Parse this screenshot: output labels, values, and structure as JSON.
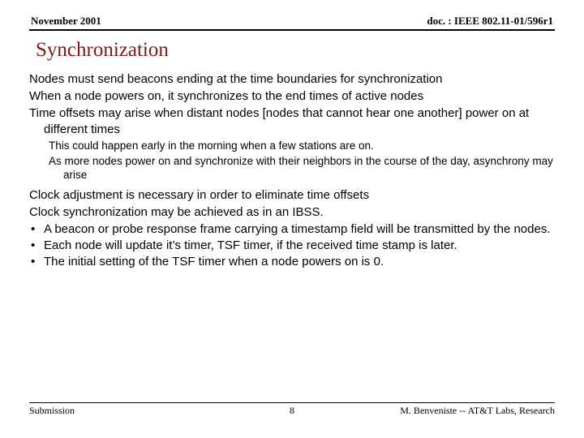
{
  "header": {
    "left": "November 2001",
    "right": "doc. : IEEE 802.11-01/596r1"
  },
  "title": "Synchronization",
  "body": {
    "p1": "Nodes must send beacons ending at the time boundaries for synchronization",
    "p2": "When a node powers on, it synchronizes to the end times of active nodes",
    "p3": "Time offsets may arise when distant nodes [nodes that cannot hear one another] power on at different times",
    "sub1": "This could happen early in the morning when a few stations are on.",
    "sub2": "As more nodes power on and synchronize with their neighbors in the course of the day, asynchrony may arise",
    "p4": "Clock adjustment is necessary in order to eliminate time offsets",
    "p5": "Clock synchronization may be achieved as in an IBSS.",
    "bullet_mark": "•",
    "b1": "A beacon or probe response frame carrying a timestamp field will be transmitted by the nodes.",
    "b2": "Each node will update it’s timer, TSF timer, if the received time stamp is later.",
    "b3": "The initial setting of the TSF timer when a node powers on is 0."
  },
  "footer": {
    "left": "Submission",
    "center": "8",
    "right": "M. Benveniste -- AT&T Labs, Research"
  }
}
